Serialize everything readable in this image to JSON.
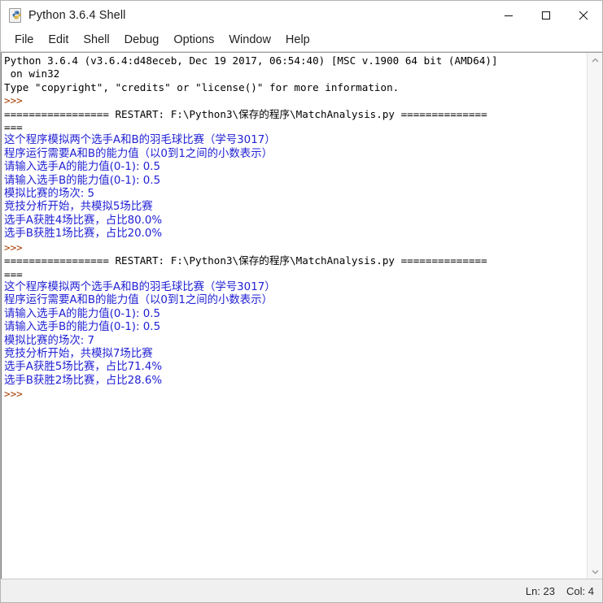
{
  "window": {
    "title": "Python 3.6.4 Shell",
    "icon": "python-file-icon",
    "controls": {
      "minimize": "minimize-icon",
      "maximize": "maximize-icon",
      "close": "close-icon"
    }
  },
  "menubar": {
    "items": [
      {
        "label": "File"
      },
      {
        "label": "Edit"
      },
      {
        "label": "Shell"
      },
      {
        "label": "Debug"
      },
      {
        "label": "Options"
      },
      {
        "label": "Window"
      },
      {
        "label": "Help"
      }
    ]
  },
  "console": {
    "lines": [
      {
        "text": "Python 3.6.4 (v3.6.4:d48eceb, Dec 19 2017, 06:54:40) [MSC v.1900 64 bit (AMD64)]",
        "color": "black",
        "cjk": false
      },
      {
        "text": " on win32",
        "color": "black",
        "cjk": false
      },
      {
        "text": "Type \"copyright\", \"credits\" or \"license()\" for more information.",
        "color": "black",
        "cjk": false
      },
      {
        "text": ">>>",
        "color": "prompt",
        "cjk": false
      },
      {
        "text": "================= RESTART: F:\\Python3\\保存的程序\\MatchAnalysis.py ==============",
        "color": "black",
        "cjk": false
      },
      {
        "text": "===",
        "color": "black",
        "cjk": false
      },
      {
        "text": "这个程序模拟两个选手A和B的羽毛球比赛（学号3017）",
        "color": "blue",
        "cjk": true
      },
      {
        "text": "程序运行需要A和B的能力值（以0到1之间的小数表示）",
        "color": "blue",
        "cjk": true
      },
      {
        "text": "请输入选手A的能力值(0-1): 0.5",
        "color": "blue",
        "cjk": true
      },
      {
        "text": "请输入选手B的能力值(0-1): 0.5",
        "color": "blue",
        "cjk": true
      },
      {
        "text": "模拟比赛的场次: 5",
        "color": "blue",
        "cjk": true
      },
      {
        "text": "竞技分析开始，共模拟5场比赛",
        "color": "blue",
        "cjk": true
      },
      {
        "text": "选手A获胜4场比赛，占比80.0%",
        "color": "blue",
        "cjk": true
      },
      {
        "text": "选手B获胜1场比赛，占比20.0%",
        "color": "blue",
        "cjk": true
      },
      {
        "text": ">>>",
        "color": "prompt",
        "cjk": false
      },
      {
        "text": "================= RESTART: F:\\Python3\\保存的程序\\MatchAnalysis.py ==============",
        "color": "black",
        "cjk": false
      },
      {
        "text": "===",
        "color": "black",
        "cjk": false
      },
      {
        "text": "这个程序模拟两个选手A和B的羽毛球比赛（学号3017）",
        "color": "blue",
        "cjk": true
      },
      {
        "text": "程序运行需要A和B的能力值（以0到1之间的小数表示）",
        "color": "blue",
        "cjk": true
      },
      {
        "text": "请输入选手A的能力值(0-1): 0.5",
        "color": "blue",
        "cjk": true
      },
      {
        "text": "请输入选手B的能力值(0-1): 0.5",
        "color": "blue",
        "cjk": true
      },
      {
        "text": "模拟比赛的场次: 7",
        "color": "blue",
        "cjk": true
      },
      {
        "text": "竞技分析开始，共模拟7场比赛",
        "color": "blue",
        "cjk": true
      },
      {
        "text": "选手A获胜5场比赛，占比71.4%",
        "color": "blue",
        "cjk": true
      },
      {
        "text": "选手B获胜2场比赛，占比28.6%",
        "color": "blue",
        "cjk": true
      },
      {
        "text": ">>>",
        "color": "prompt",
        "cjk": false
      }
    ]
  },
  "scrollbar": {
    "up_arrow": "chevron-up-icon",
    "down_arrow": "chevron-down-icon"
  },
  "statusbar": {
    "line": "Ln: 23",
    "column": "Col: 4"
  },
  "colors": {
    "output_blue": "#2121d4",
    "prompt_brown": "#a63a00",
    "text_black": "#000000",
    "window_bg": "#ffffff",
    "statusbar_bg": "#f0f0f0"
  }
}
